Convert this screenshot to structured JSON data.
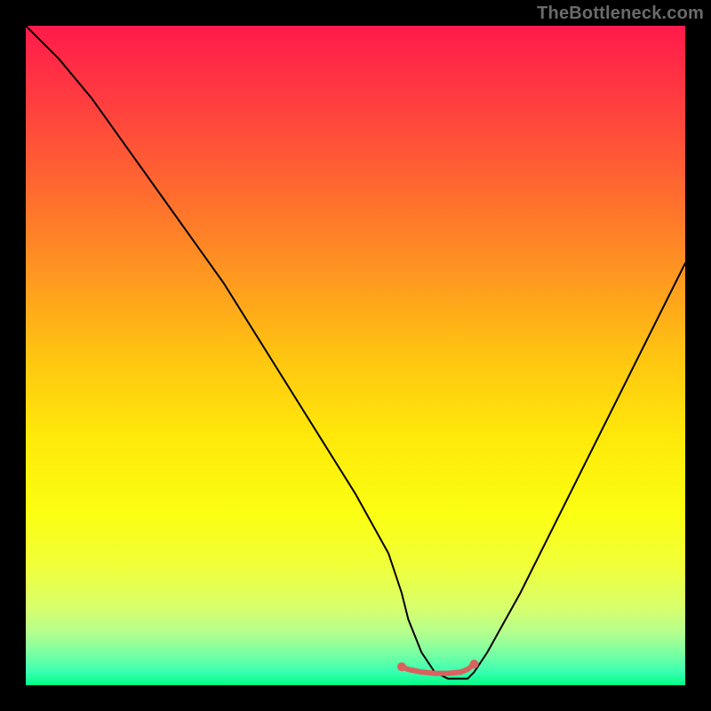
{
  "watermark": "TheBottleneck.com",
  "chart_data": {
    "type": "line",
    "title": "",
    "xlabel": "",
    "ylabel": "",
    "xlim": [
      0,
      100
    ],
    "ylim": [
      0,
      100
    ],
    "grid": false,
    "series": [
      {
        "name": "curve",
        "color": "#000000",
        "x": [
          0,
          5,
          10,
          15,
          20,
          25,
          30,
          35,
          40,
          45,
          50,
          55,
          57,
          58,
          60,
          62,
          64,
          66,
          67,
          68,
          70,
          75,
          80,
          85,
          90,
          95,
          100
        ],
        "values": [
          100,
          95,
          89,
          82,
          75,
          68,
          61,
          53,
          45,
          37,
          29,
          20,
          14,
          10,
          5,
          2,
          1,
          1,
          1,
          2,
          5,
          14,
          24,
          34,
          44,
          54,
          64
        ]
      },
      {
        "name": "optimal-range",
        "color": "#d9625f",
        "marker": "dot",
        "x": [
          57,
          58,
          60,
          62,
          64,
          66,
          67,
          68
        ],
        "values": [
          2.8,
          2.4,
          2.0,
          1.8,
          1.8,
          2.0,
          2.4,
          3.2
        ]
      }
    ]
  }
}
